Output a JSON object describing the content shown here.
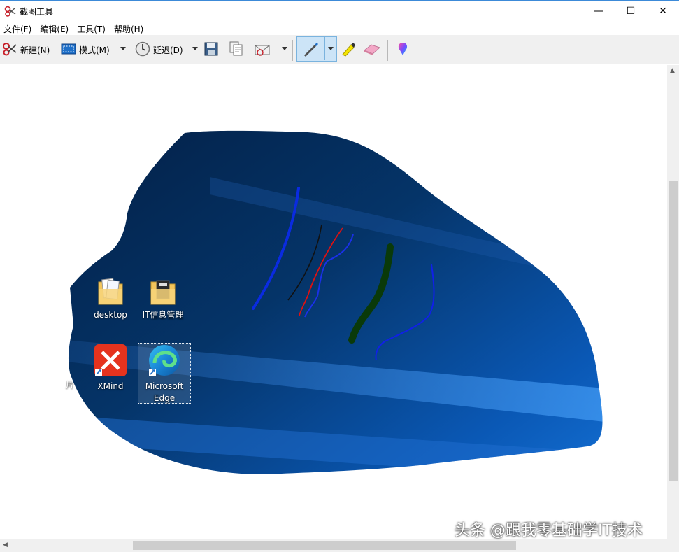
{
  "window": {
    "title": "截图工具",
    "minimize_glyph": "—",
    "maximize_glyph": "☐",
    "close_glyph": "✕"
  },
  "menu": [
    "文件(F)",
    "编辑(E)",
    "工具(T)",
    "帮助(H)"
  ],
  "toolbar": {
    "new_label": "新建(N)",
    "mode_label": "模式(M)",
    "delay_label": "延迟(D)",
    "icons": [
      "scissors-icon",
      "mode-icon",
      "clock-icon",
      "save-icon",
      "copy-icon",
      "send-email-icon",
      "pen-icon",
      "highlighter-icon",
      "eraser-icon",
      "paint3d-icon"
    ]
  },
  "desktop_icons": [
    {
      "label": "desktop",
      "icon": "folder-icon"
    },
    {
      "label": "IT信息管理",
      "icon": "folder-icon"
    },
    {
      "label": "XMind",
      "icon": "xmind-icon"
    },
    {
      "label_line1": "Microsoft",
      "label_line2": "Edge",
      "icon": "edge-icon"
    }
  ],
  "partial_label": "片",
  "pen_colors": {
    "blue": "#0a2be0",
    "black": "#111111",
    "red": "#e01010",
    "green": "#0a3a0a",
    "accent": "#3c8ad8"
  },
  "watermark": "头条 @跟我零基础学IT技术"
}
